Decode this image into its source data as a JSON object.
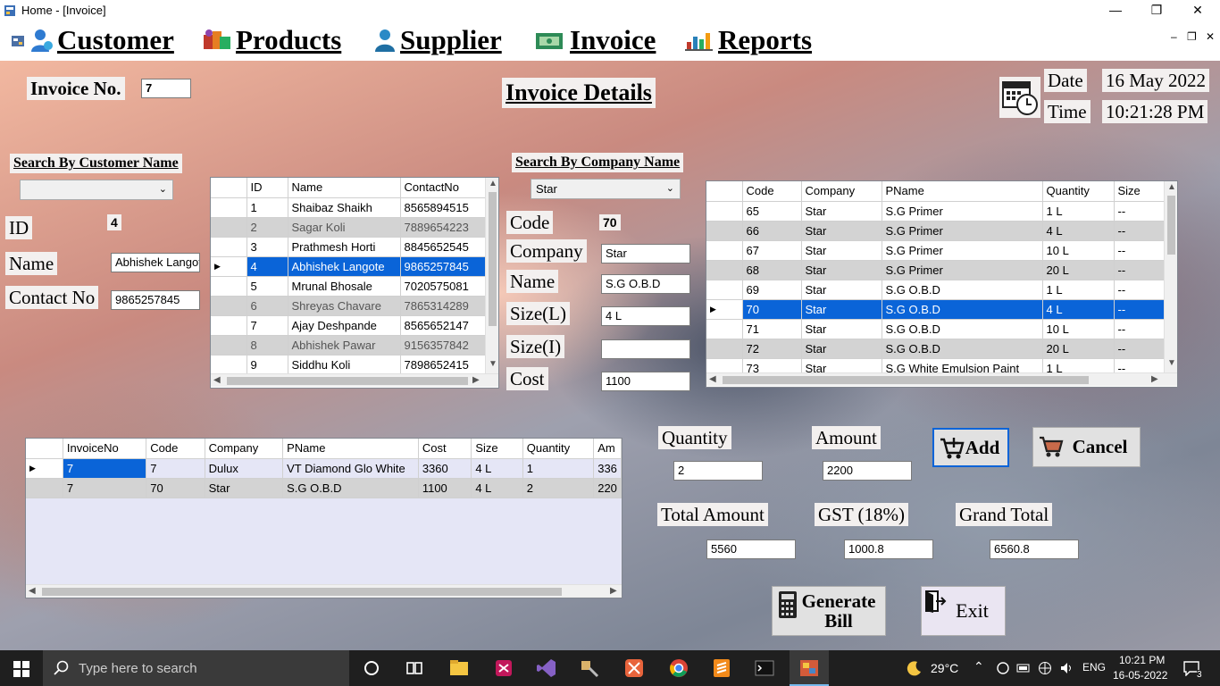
{
  "window": {
    "title": "Home - [Invoice]"
  },
  "menu": {
    "customer": "Customer",
    "products": "Products",
    "supplier": "Supplier",
    "invoice": "Invoice",
    "reports": "Reports"
  },
  "form": {
    "invoice_no_label": "Invoice No.",
    "invoice_no": "7",
    "heading": "Invoice Details",
    "date_label": "Date",
    "date": "16 May 2022",
    "time_label": "Time",
    "time": "10:21:28 PM",
    "search_customer_label": "Search By Customer Name",
    "search_customer_value": "",
    "id_label": "ID",
    "id_value": "4",
    "name_label": "Name",
    "name_value": "Abhishek Langote",
    "contact_label": "Contact No",
    "contact_value": "9865257845",
    "search_company_label": "Search By Company Name",
    "search_company_value": "Star",
    "code_label": "Code",
    "code_value": "70",
    "company_label": "Company",
    "company_value": "Star",
    "pname_label": "Name",
    "pname_value": "S.G O.B.D",
    "size_l_label": "Size(L)",
    "size_l_value": "4 L",
    "size_i_label": "Size(I)",
    "size_i_value": "",
    "cost_label": "Cost",
    "cost_value": "1100",
    "quantity_label": "Quantity",
    "quantity_value": "2",
    "amount_label": "Amount",
    "amount_value": "2200",
    "add_label": "Add",
    "cancel_label": "Cancel",
    "total_amount_label": "Total Amount",
    "total_amount_value": "5560",
    "gst_label": "GST (18%)",
    "gst_value": "1000.8",
    "grand_total_label": "Grand Total",
    "grand_total_value": "6560.8",
    "generate_bill_label_1": "Generate",
    "generate_bill_label_2": "Bill",
    "exit_label": "Exit"
  },
  "customers": {
    "headers": [
      "ID",
      "Name",
      "ContactNo"
    ],
    "rows": [
      [
        "1",
        "Shaibaz Shaikh",
        "8565894515"
      ],
      [
        "2",
        "Sagar Koli",
        "7889654223"
      ],
      [
        "3",
        "Prathmesh Horti",
        "8845652545"
      ],
      [
        "4",
        "Abhishek Langote",
        "9865257845"
      ],
      [
        "5",
        "Mrunal Bhosale",
        "7020575081"
      ],
      [
        "6",
        "Shreyas Chavare",
        "7865314289"
      ],
      [
        "7",
        "Ajay Deshpande",
        "8565652147"
      ],
      [
        "8",
        "Abhishek Pawar",
        "9156357842"
      ],
      [
        "9",
        "Siddhu Koli",
        "7898652415"
      ]
    ]
  },
  "products": {
    "headers": [
      "Code",
      "Company",
      "PName",
      "Quantity",
      "Size"
    ],
    "rows": [
      [
        "65",
        "Star",
        "S.G Primer",
        "1 L",
        "--"
      ],
      [
        "66",
        "Star",
        "S.G Primer",
        "4 L",
        "--"
      ],
      [
        "67",
        "Star",
        "S.G Primer",
        "10 L",
        "--"
      ],
      [
        "68",
        "Star",
        "S.G Primer",
        "20 L",
        "--"
      ],
      [
        "69",
        "Star",
        "S.G O.B.D",
        "1 L",
        "--"
      ],
      [
        "70",
        "Star",
        "S.G O.B.D",
        "4 L",
        "--"
      ],
      [
        "71",
        "Star",
        "S.G O.B.D",
        "10 L",
        "--"
      ],
      [
        "72",
        "Star",
        "S.G O.B.D",
        "20 L",
        "--"
      ],
      [
        "73",
        "Star",
        "S.G White Emulsion Paint",
        "1 L",
        "--"
      ]
    ]
  },
  "invoice_items": {
    "headers": [
      "InvoiceNo",
      "Code",
      "Company",
      "PName",
      "Cost",
      "Size",
      "Quantity",
      "Am"
    ],
    "rows": [
      [
        "7",
        "7",
        "Dulux",
        "VT Diamond Glo White",
        "3360",
        "4 L",
        "1",
        "336"
      ],
      [
        "7",
        "70",
        "Star",
        "S.G O.B.D",
        "1100",
        "4 L",
        "2",
        "220"
      ]
    ]
  },
  "taskbar": {
    "search_placeholder": "Type here to search",
    "weather": "29°C",
    "lang": "ENG",
    "clock_time": "10:21 PM",
    "clock_date": "16-05-2022",
    "notifications": "3"
  }
}
